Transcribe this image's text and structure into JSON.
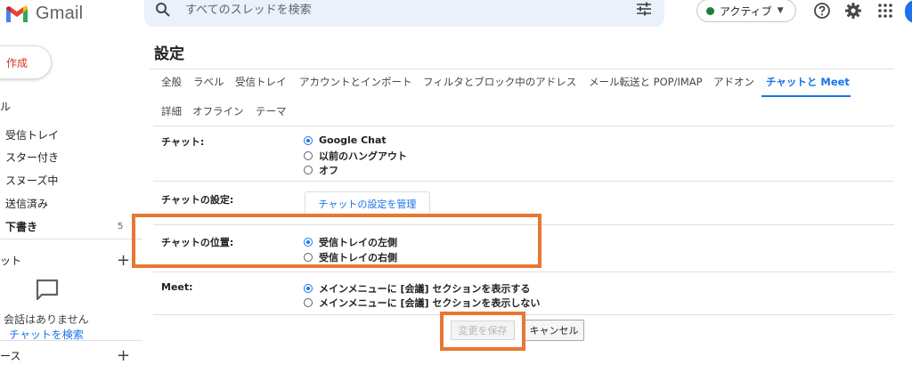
{
  "header": {
    "app_name": "Gmail",
    "search_placeholder": "すべてのスレッドを検索",
    "status_label": "アクティブ",
    "status_color": "#188038",
    "icons": [
      "gmail-logo",
      "search-icon",
      "tune-icon",
      "help-icon",
      "gear-icon",
      "apps-grid-icon"
    ]
  },
  "sidebar": {
    "compose_label": "作成",
    "section_mail_fragment": "ル",
    "items": [
      {
        "label": "受信トレイ"
      },
      {
        "label": "スター付き"
      },
      {
        "label": "スヌーズ中"
      },
      {
        "label": "送信済み"
      },
      {
        "label": "下書き",
        "count": "5"
      }
    ],
    "chat_section_fragment": "ット",
    "no_chat_text": "会話はありません",
    "chat_search_link": "チャットを検索",
    "spaces_section_fragment": "ース"
  },
  "settings": {
    "title": "設定",
    "tabs": [
      {
        "label": "全般"
      },
      {
        "label": "ラベル"
      },
      {
        "label": "受信トレイ"
      },
      {
        "label": "アカウントとインポート"
      },
      {
        "label": "フィルタとブロック中のアドレス"
      },
      {
        "label": "メール転送と POP/IMAP"
      },
      {
        "label": "アドオン"
      },
      {
        "label": "チャットと Meet",
        "active": true
      },
      {
        "label": "詳細"
      },
      {
        "label": "オフライン"
      },
      {
        "label": "テーマ"
      }
    ],
    "rows": {
      "chat": {
        "label": "チャット:",
        "options": [
          {
            "label": "Google Chat",
            "checked": true
          },
          {
            "label": "以前のハングアウト",
            "checked": false
          },
          {
            "label": "オフ",
            "checked": false
          }
        ]
      },
      "chat_settings": {
        "label": "チャットの設定:",
        "button": "チャットの設定を管理"
      },
      "chat_position": {
        "label": "チャットの位置:",
        "options": [
          {
            "label": "受信トレイの左側",
            "checked": true
          },
          {
            "label": "受信トレイの右側",
            "checked": false
          }
        ]
      },
      "meet": {
        "label": "Meet:",
        "options": [
          {
            "label": "メインメニューに [会議] セクションを表示する",
            "checked": true
          },
          {
            "label": "メインメニューに [会議] セクションを表示しない",
            "checked": false
          }
        ]
      }
    },
    "save_button": "変更を保存",
    "save_disabled": true,
    "cancel_button": "キャンセル"
  },
  "annotations": {
    "highlight_color": "#e87732"
  }
}
